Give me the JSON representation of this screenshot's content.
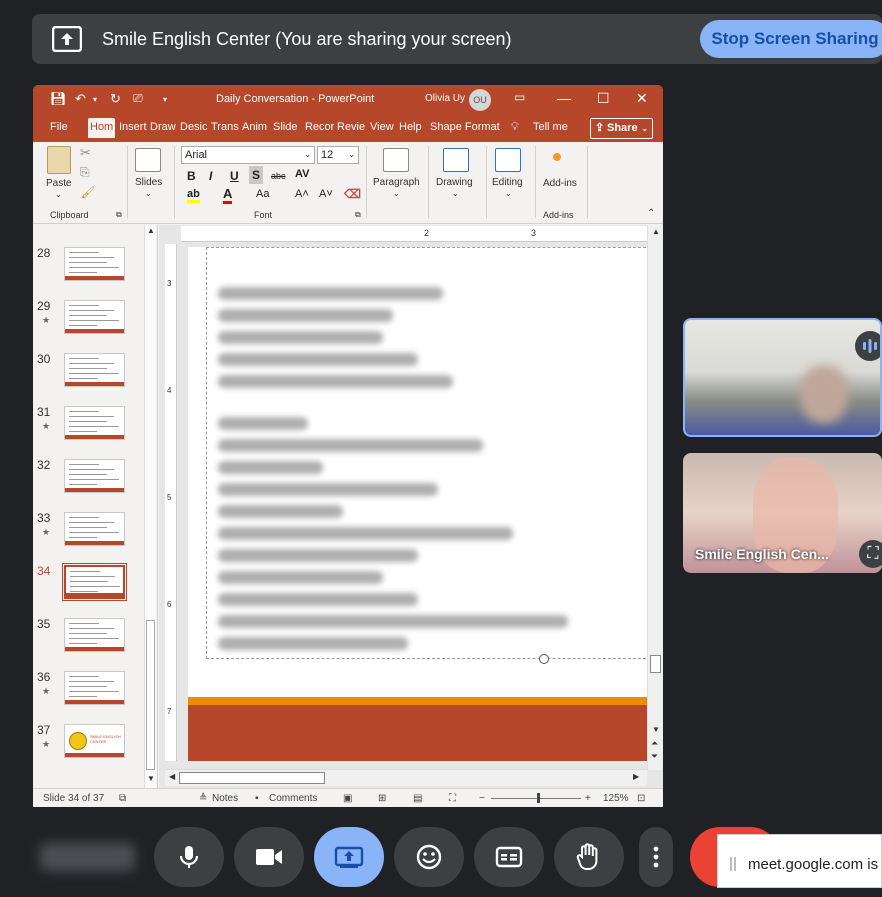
{
  "meeting": {
    "share_banner": "Smile English Center (You are sharing your screen)",
    "stop_button": "Stop Screen Sharing",
    "accent": "#8ab4f8",
    "end_color": "#ea4335"
  },
  "powerpoint": {
    "title": "Daily Conversation  -  PowerPoint",
    "user_name": "Olivia Uy",
    "user_initials": "OU",
    "brand_color": "#b7472a",
    "tabs": [
      "File",
      "Hom",
      "Insert",
      "Draw",
      "Desic",
      "Trans",
      "Anim",
      "Slide",
      "Recor",
      "Revie",
      "View",
      "Help",
      "Shape Format"
    ],
    "tell_me": "Tell me",
    "share": "Share",
    "ribbon": {
      "paste": "Paste",
      "clipboard": "Clipboard",
      "slides": "Slides",
      "font_name": "Arial",
      "font_size": "12",
      "font_group": "Font",
      "paragraph": "Paragraph",
      "drawing": "Drawing",
      "editing": "Editing",
      "addins": "Add-ins",
      "addins_group": "Add-ins",
      "bold": "B",
      "italic": "I",
      "underline": "U",
      "shadow": "S",
      "strike": "abc",
      "spacing": "AV"
    },
    "thumbnails": [
      {
        "num": "28",
        "star": false
      },
      {
        "num": "29",
        "star": true
      },
      {
        "num": "30",
        "star": false
      },
      {
        "num": "31",
        "star": true
      },
      {
        "num": "32",
        "star": false
      },
      {
        "num": "33",
        "star": true
      },
      {
        "num": "34",
        "star": false,
        "selected": true
      },
      {
        "num": "35",
        "star": false
      },
      {
        "num": "36",
        "star": true
      },
      {
        "num": "37",
        "star": true
      }
    ],
    "thumb_logo_text": "SMILE ENGLISH CENTER",
    "ruler_h": [
      "2",
      "3"
    ],
    "ruler_v": [
      "3",
      "4",
      "5",
      "6",
      "7"
    ],
    "status": {
      "slide": "Slide 34 of 37",
      "notes": "Notes",
      "comments": "Comments",
      "zoom": "125%"
    }
  },
  "participants": [
    {
      "name": ""
    },
    {
      "name": "Smile English Cen..."
    }
  ],
  "notification": "meet.google.com is"
}
